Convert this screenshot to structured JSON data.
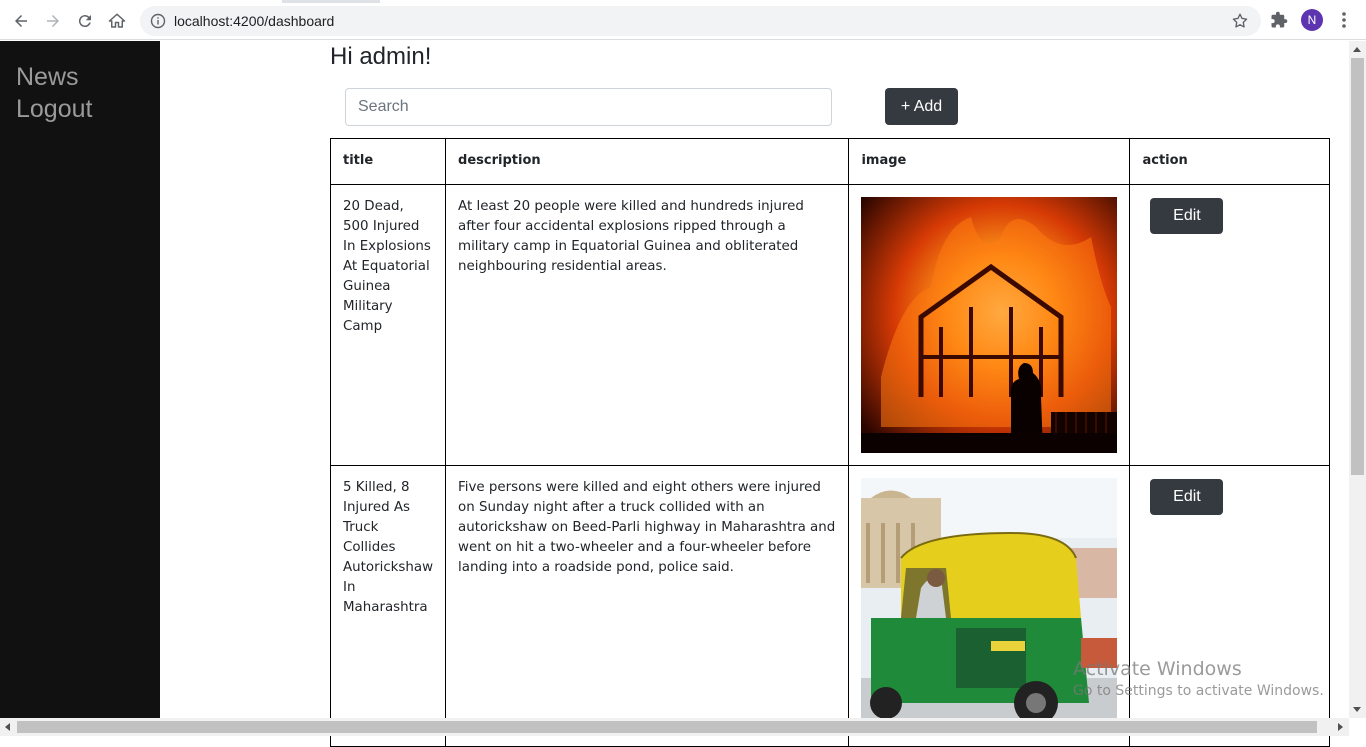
{
  "browser": {
    "url": "localhost:4200/dashboard",
    "profile_initial": "N",
    "icons": [
      "back-icon",
      "forward-icon",
      "reload-icon",
      "home-icon",
      "info-icon",
      "star-icon",
      "extensions-icon",
      "menu-icon"
    ]
  },
  "sidebar": {
    "items": [
      {
        "label": "News"
      },
      {
        "label": "Logout"
      }
    ]
  },
  "main": {
    "greeting": "Hi admin!",
    "search_placeholder": "Search",
    "add_label": "+ Add"
  },
  "table": {
    "headers": [
      "title",
      "description",
      "image",
      "action"
    ],
    "rows": [
      {
        "title": "20 Dead, 500 Injured In Explosions At Equatorial Guinea Military Camp",
        "description": "At least 20 people were killed and hundreds injured after four accidental explosions ripped through a military camp in Equatorial Guinea and obliterated neighbouring residential areas.",
        "image": "burning-house-photo",
        "action_label": "Edit"
      },
      {
        "title": "5 Killed, 8 Injured As Truck Collides Autorickshaw In Maharashtra",
        "description": "Five persons were killed and eight others were injured on Sunday night after a truck collided with an autorickshaw on Beed-Parli highway in Maharashtra and went on hit a two-wheeler and a four-wheeler before landing into a roadside pond, police said.",
        "image": "autorickshaw-photo",
        "action_label": "Edit"
      }
    ]
  },
  "watermark": {
    "line1": "Activate Windows",
    "line2": "Go to Settings to activate Windows."
  },
  "colors": {
    "sidebar_bg": "#111111",
    "button_bg": "#343a40",
    "avatar_bg": "#5e35b1"
  }
}
